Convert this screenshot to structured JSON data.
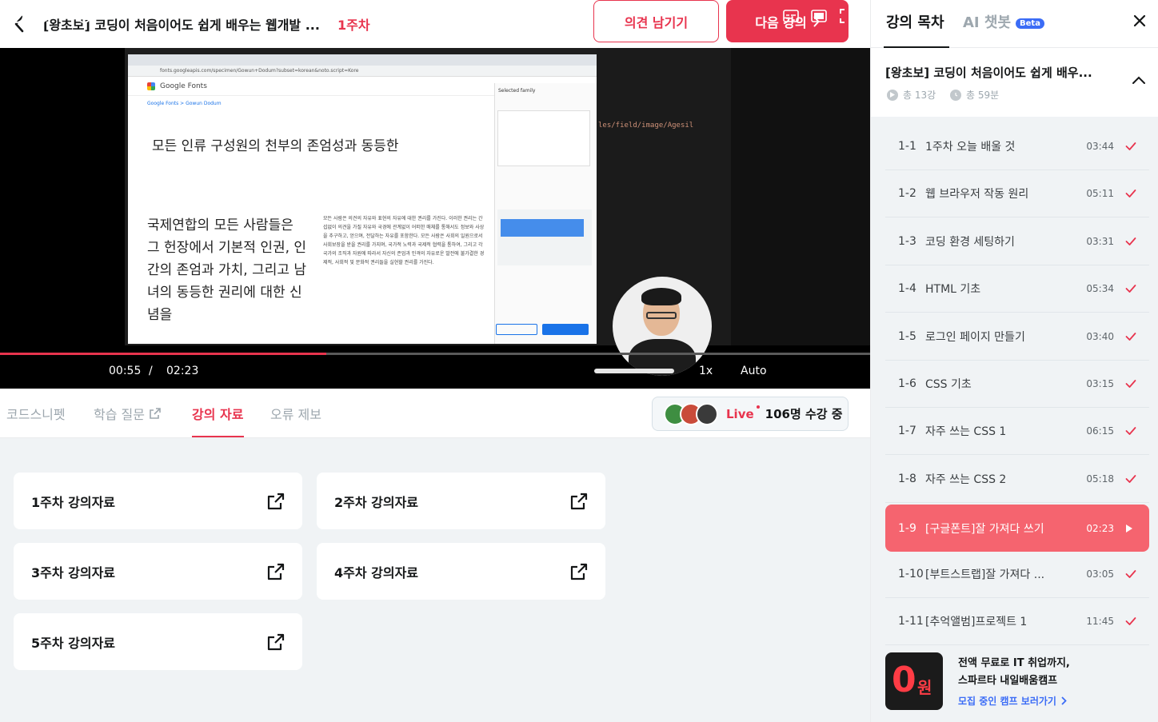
{
  "header": {
    "course_title": "[왕초보] 코딩이 처음이어도 쉽게 배우는 웹개발 ...",
    "week_tag": "1주차",
    "feedback_label": "의견 남기기",
    "next_label": "다음 강의"
  },
  "video": {
    "browser_url": "fonts.googleapis.com/specimen/Gowun+Dodum?subset=korean&noto.script=Kore",
    "gf_name": "Google Fonts",
    "gf_crumb": "Google Fonts > Gowun Dodum",
    "gf_panel_title": "Selected family",
    "gf_preview": "모든 인류 구성원의 천부의 존엄성과 동등한",
    "gf_big": "국제연합의 모든 사람들은 그 헌장에서 기본적 인권, 인간의 존엄과 가치, 그리고 남녀의 동등한 권리에 대한 신념을",
    "gf_small": "모든 사람은 의견의 자유와 표현의 자유에 대한 권리를 가진다. 이러한 권리는 간섭없이 의견을 가질 자유와 국경에 관계없이 어떠한 매체를 통해서도 정보와 사상을 추구하고, 얻으며, 전달하는 자유를 포함한다. 모든 사람은 사회의 일원으로서 사회보장을 받을 권리를 가지며, 국가적 노력과 국제적 협력을 통하여, 그리고 각 국가의 조직과 자원에 따라서 자신의 존엄과 인격의 자유로운 발전에 불가결한 경제적, 사회적 및 문화적 권리들을 실현할 권리를 가진다.",
    "editor_code": "les/field/image/Agesil",
    "current_time": "00:55",
    "separator": "/",
    "total_time": "02:23",
    "speed": "1x",
    "quality": "Auto",
    "progress": 0.375,
    "volume": 1.0
  },
  "tabs": {
    "items": [
      {
        "label": "코드스니펫"
      },
      {
        "label": "학습 질문"
      },
      {
        "label": "강의 자료"
      },
      {
        "label": "오류 제보"
      }
    ],
    "active": 2
  },
  "live": {
    "label": "Live",
    "viewers": "106명 수강 중"
  },
  "materials": [
    {
      "label": "1주차 강의자료"
    },
    {
      "label": "2주차 강의자료"
    },
    {
      "label": "3주차 강의자료"
    },
    {
      "label": "4주차 강의자료"
    },
    {
      "label": "5주차 강의자료"
    }
  ],
  "sidebar": {
    "tab_toc": "강의 목차",
    "tab_ai": "AI 챗봇",
    "beta": "Beta",
    "course_title": "[왕초보] 코딩이 처음이어도 쉽게 배우...",
    "total_lessons": "총 13강",
    "total_time": "총 59분",
    "lessons": [
      {
        "num": "1-1",
        "title": "1주차 오늘 배울 것",
        "dur": "03:44",
        "done": true
      },
      {
        "num": "1-2",
        "title": "웹 브라우저 작동 원리",
        "dur": "05:11",
        "done": true
      },
      {
        "num": "1-3",
        "title": "코딩 환경 세팅하기",
        "dur": "03:31",
        "done": true
      },
      {
        "num": "1-4",
        "title": "HTML 기초",
        "dur": "05:34",
        "done": true
      },
      {
        "num": "1-5",
        "title": "로그인 페이지 만들기",
        "dur": "03:40",
        "done": true
      },
      {
        "num": "1-6",
        "title": "CSS 기초",
        "dur": "03:15",
        "done": true
      },
      {
        "num": "1-7",
        "title": "자주 쓰는 CSS 1",
        "dur": "06:15",
        "done": true
      },
      {
        "num": "1-8",
        "title": "자주 쓰는 CSS 2",
        "dur": "05:18",
        "done": true
      },
      {
        "num": "1-9",
        "title": "[구글폰트]잘 가져다 쓰기",
        "dur": "02:23",
        "done": false
      },
      {
        "num": "1-10",
        "title": "[부트스트랩]잘 가져다 ...",
        "dur": "03:05",
        "done": true
      },
      {
        "num": "1-11",
        "title": "[추억앨범]프로젝트 1",
        "dur": "11:45",
        "done": true
      }
    ],
    "active_lesson": 8
  },
  "promo": {
    "badge_zero": "0",
    "badge_won": "원",
    "line1": "전액 무료로 IT 취업까지,",
    "line2": "스파르타 내일배움캠프",
    "link": "모집 중인 캠프 보러가기"
  },
  "colors": {
    "accent": "#e8344e",
    "active_lesson_bg": "#f5646f",
    "beta_blue": "#3b6cf6"
  }
}
